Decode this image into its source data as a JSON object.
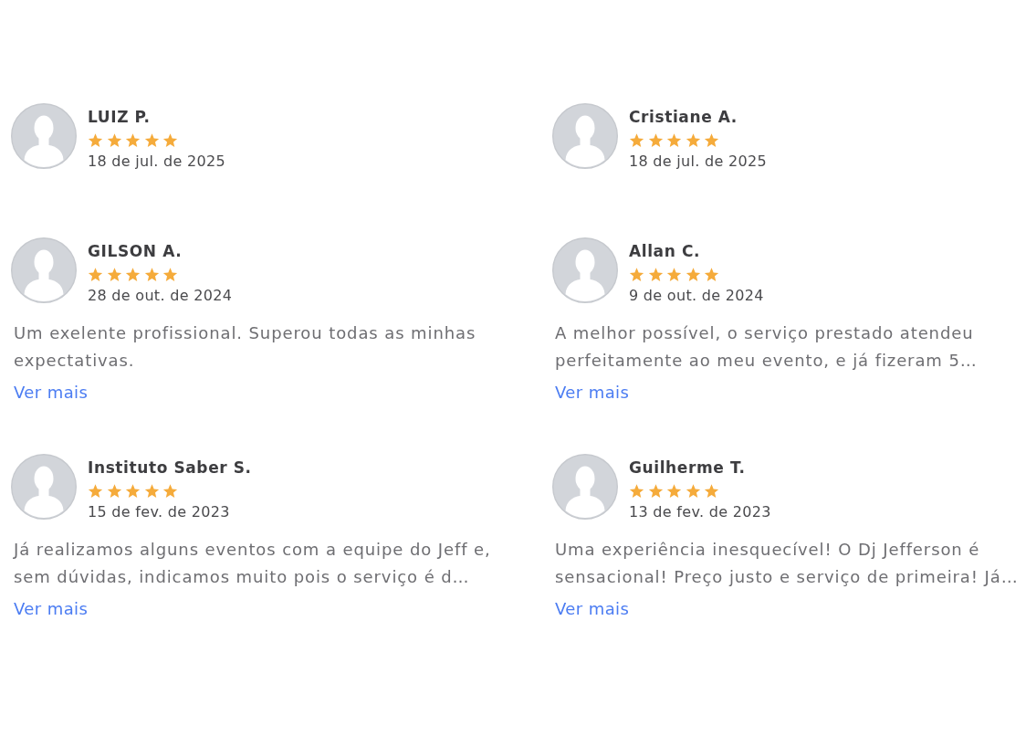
{
  "reviews": [
    {
      "name": "LUIZ P.",
      "stars": 5,
      "date": "18 de jul. de 2025"
    },
    {
      "name": "Cristiane A.",
      "stars": 5,
      "date": "18 de jul. de 2025"
    },
    {
      "name": "GILSON A.",
      "stars": 5,
      "date": "28 de out. de 2024",
      "text": "Um exelente profissional. Superou todas as minhas expectativas.",
      "link": "Ver mais"
    },
    {
      "name": "Allan C.",
      "stars": 5,
      "date": "9 de out. de 2024",
      "text": "A melhor possível, o serviço prestado atendeu perfeitamente ao meu evento, e já fizeram 5…",
      "link": "Ver mais"
    },
    {
      "name": "Instituto Saber S.",
      "stars": 5,
      "date": "15 de fev. de 2023",
      "text": "Já realizamos alguns eventos com a equipe do Jeff e, sem dúvidas, indicamos muito pois o serviço é d…",
      "link": "Ver mais"
    },
    {
      "name": "Guilherme T.",
      "stars": 5,
      "date": "13 de fev. de 2023",
      "text": "Uma experiência inesquecível! O Dj Jefferson é sensacional! Preço justo e serviço de primeira! Já…",
      "link": "Ver mais"
    }
  ]
}
